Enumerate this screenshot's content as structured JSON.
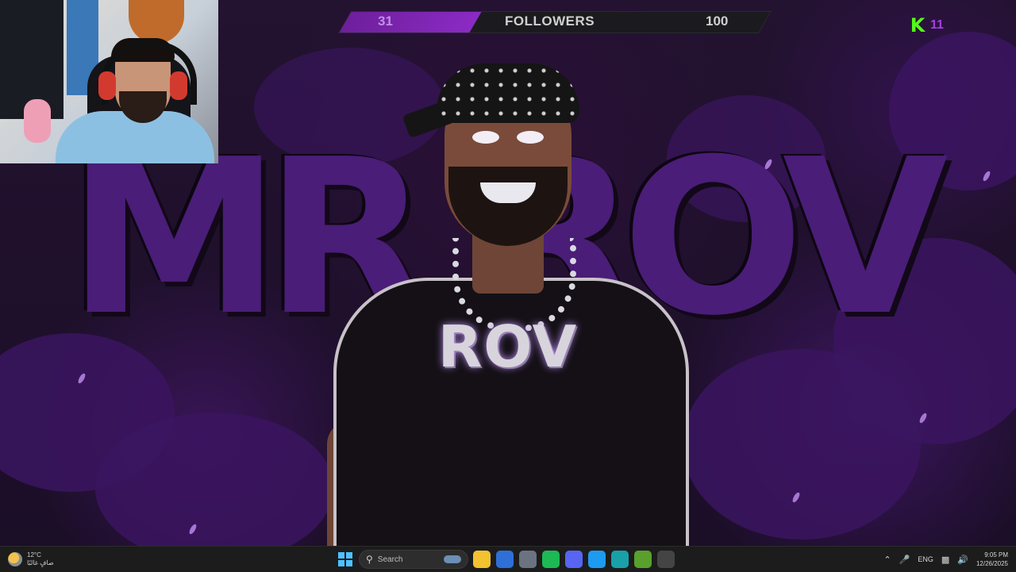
{
  "overlay": {
    "followers": {
      "current": "31",
      "label": "FOLLOWERS",
      "goal": "100",
      "progress_fraction": 0.31,
      "fill_color": "#8b2ac4"
    },
    "kick": {
      "logo_glyph": "K",
      "viewer_count": "11",
      "logo_color": "#53fc18",
      "count_color": "#a63ee8"
    }
  },
  "wallpaper": {
    "graffiti_text": "MR ROV",
    "shirt_text": "ROV",
    "accent_color": "#4a1d78"
  },
  "taskbar": {
    "weather": {
      "icon": "partly-cloudy-icon",
      "temperature": "12°C",
      "condition": "صافٍ غالبًا"
    },
    "start_icon": "windows-start-icon",
    "search": {
      "icon": "search-icon",
      "placeholder": "Search"
    },
    "pinned_apps": [
      {
        "name": "file-explorer-icon",
        "color": "#f2c230"
      },
      {
        "name": "microsoft-store-icon",
        "color": "#2f6fd8"
      },
      {
        "name": "settings-icon",
        "color": "#6b7280"
      },
      {
        "name": "spotify-icon",
        "color": "#1db954"
      },
      {
        "name": "discord-icon",
        "color": "#5865f2"
      },
      {
        "name": "twitter-icon",
        "color": "#1d9bf0"
      },
      {
        "name": "edge-icon",
        "color": "#1aa0a8"
      },
      {
        "name": "minecraft-icon",
        "color": "#5aa02c"
      },
      {
        "name": "obs-icon",
        "color": "#444444"
      }
    ],
    "tray": {
      "language": "ENG",
      "time": "9:05 PM",
      "date": "12/26/2025"
    }
  }
}
